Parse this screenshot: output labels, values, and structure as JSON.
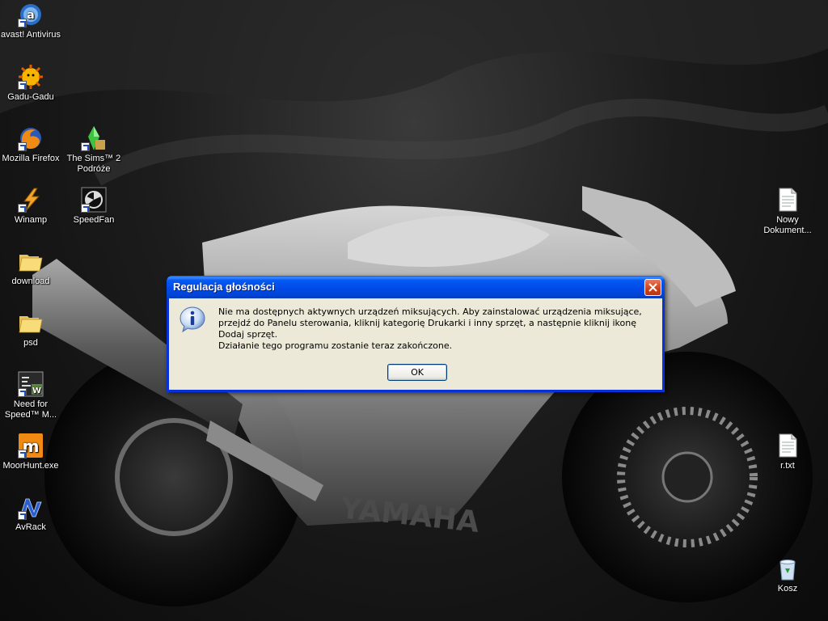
{
  "desktop": {
    "icons": [
      {
        "label": "avast! Antivirus",
        "icon": "avast-icon"
      },
      {
        "label": "Gadu-Gadu",
        "icon": "gadu-gadu-icon"
      },
      {
        "label": "Mozilla Firefox",
        "icon": "firefox-icon"
      },
      {
        "label": "The Sims™ 2 Podróże",
        "icon": "sims-icon"
      },
      {
        "label": "Winamp",
        "icon": "winamp-icon"
      },
      {
        "label": "SpeedFan",
        "icon": "speedfan-icon"
      },
      {
        "label": "download",
        "icon": "folder-icon"
      },
      {
        "label": "psd",
        "icon": "folder-icon"
      },
      {
        "label": "Need for Speed™ M...",
        "icon": "need-for-speed-icon"
      },
      {
        "label": "MoorHunt.exe",
        "icon": "moorhunt-icon"
      },
      {
        "label": "AvRack",
        "icon": "avrack-icon"
      },
      {
        "label": "Nowy Dokument...",
        "icon": "text-document-icon"
      },
      {
        "label": "r.txt",
        "icon": "text-document-icon"
      },
      {
        "label": "Kosz",
        "icon": "recycle-bin-icon"
      }
    ],
    "wallpaper_text": "YAMAHA"
  },
  "dialog": {
    "title": "Regulacja głośności",
    "message_line1": "Nie ma dostępnych aktywnych urządzeń miksujących. Aby zainstalować urządzenia miksujące, przejdź do Panelu sterowania, kliknij kategorię Drukarki i inny sprzęt, a następnie kliknij ikonę Dodaj sprzęt.",
    "message_line2": "Działanie tego programu zostanie teraz zakończone.",
    "ok_label": "OK",
    "icon": "information-icon"
  },
  "colors": {
    "titlebar": "#0054e3",
    "dialog_bg": "#ece9d8",
    "close_button": "#c8431c"
  }
}
